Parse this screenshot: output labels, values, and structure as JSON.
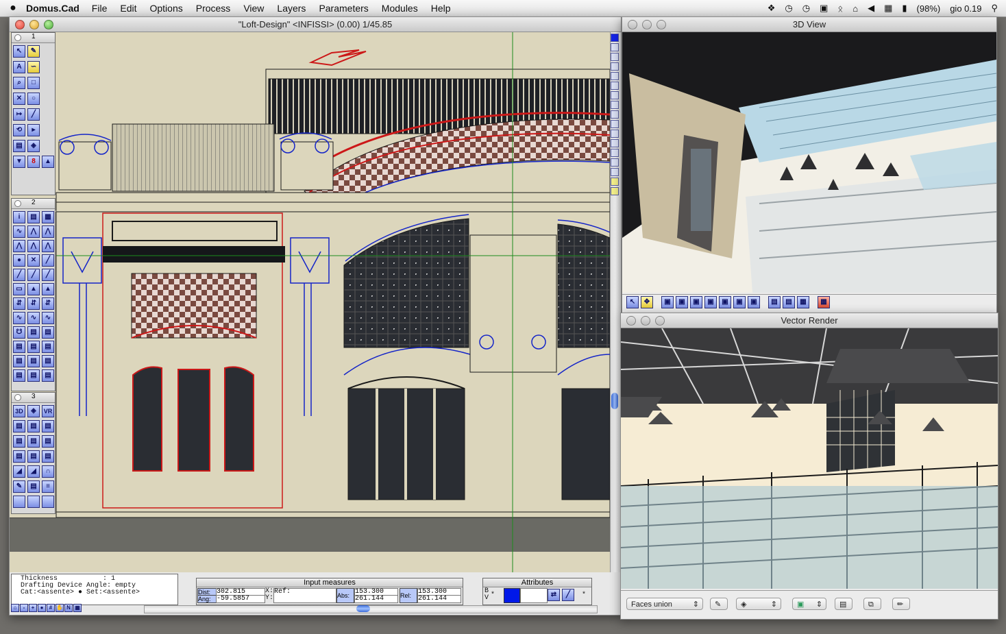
{
  "menubar": {
    "apple": "",
    "app_name": "Domus.Cad",
    "items": [
      "File",
      "Edit",
      "Options",
      "Process",
      "View",
      "Layers",
      "Parameters",
      "Modules",
      "Help"
    ],
    "battery": "(98%)",
    "clock": "gio 0.19"
  },
  "main_window": {
    "title": "\"Loft-Design\" <INFISSI> (0.00) 1/45.85",
    "palettes": [
      {
        "number": "1"
      },
      {
        "number": "2"
      },
      {
        "number": "3"
      }
    ],
    "tool_glyphs": {
      "three_d": "3D",
      "vr": "VR",
      "eight": "8",
      "text_a": "A",
      "n": "N"
    }
  },
  "info_panel": {
    "line1": "Thickness           : 1",
    "line2": "Drafting Device Angle: empty",
    "line3": "Cat:<assente> ● Set:<assente>"
  },
  "input_measures": {
    "title": "Input measures",
    "dist_label": "Dist:",
    "ang_label": "Ang:",
    "dist_value": "302.815",
    "ang_value": "-59.5857",
    "x_label": "X:",
    "y_label": "Y:",
    "ref_label": "Ref:",
    "abs_label": "Abs:",
    "abs_x": "153.300",
    "abs_y": "261.144",
    "rel_label": "Rel:",
    "rel_x": "153.300",
    "rel_y": "261.144"
  },
  "attributes": {
    "title": "Attributes",
    "b_label": "B",
    "v_label": "V",
    "star": "*",
    "accent_color": "#0018e8"
  },
  "view3d": {
    "title": "3D View"
  },
  "vector_render": {
    "title": "Vector Render",
    "faces_select": "Faces union"
  },
  "colors": {
    "cad_bg": "#dcd6bc",
    "cad_line": "#1a1a1a",
    "cad_red": "#cc1818",
    "cad_blue": "#1424c8",
    "checker_light": "#e8d8d2",
    "checker_dark": "#7a4a40"
  }
}
